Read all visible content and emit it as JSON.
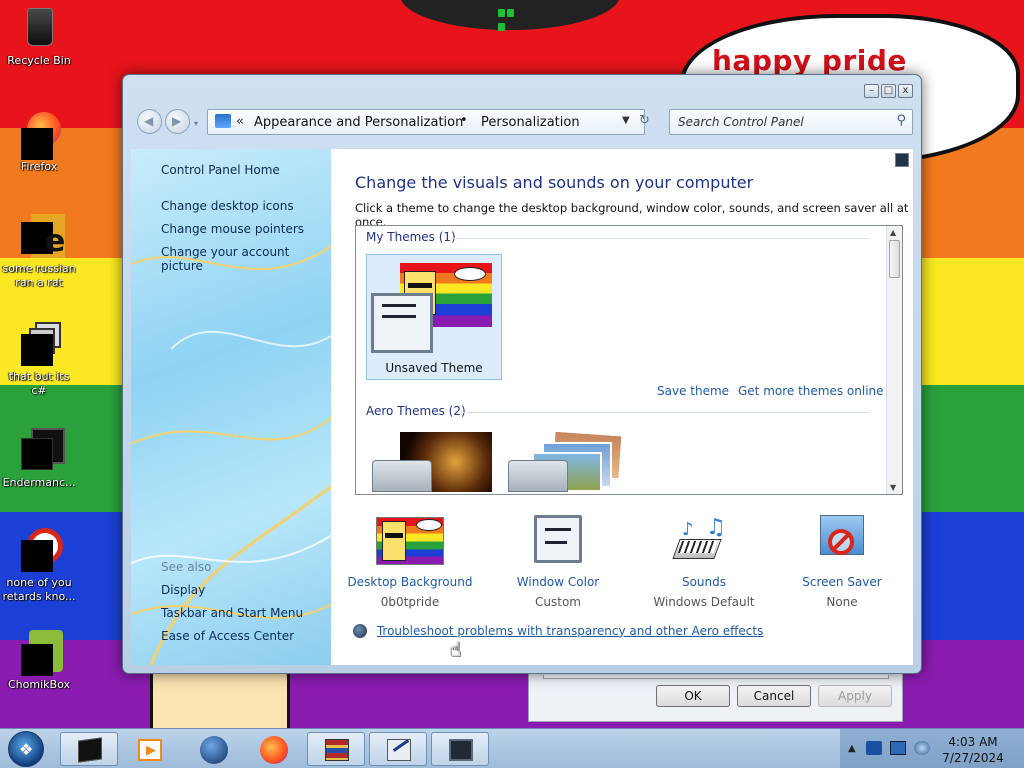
{
  "desktop": {
    "speech_text": "happy pride month",
    "icons": [
      {
        "label": "Recycle Bin",
        "icon": "recycle-bin-icon"
      },
      {
        "label": "Firefox",
        "icon": "firefox-icon"
      },
      {
        "label": "some russian ran a rat",
        "icon": "app-icon"
      },
      {
        "label": "that but its c#",
        "icon": "app-icon"
      },
      {
        "label": "Endermanc...",
        "icon": "app-icon"
      },
      {
        "label": "none of you retards kno...",
        "icon": "app-icon"
      },
      {
        "label": "ChomikBox",
        "icon": "chomikbox-icon"
      }
    ]
  },
  "window": {
    "breadcrumb": {
      "crumb1": "Appearance and Personalization",
      "crumb2": "Personalization"
    },
    "search_placeholder": "Search Control Panel",
    "caption": {
      "minimize": "–",
      "maximize": "□",
      "close": "x"
    },
    "left_pane": {
      "home": "Control Panel Home",
      "links": [
        "Change desktop icons",
        "Change mouse pointers",
        "Change your account picture"
      ],
      "see_also_title": "See also",
      "see_also": [
        "Display",
        "Taskbar and Start Menu",
        "Ease of Access Center"
      ]
    },
    "content": {
      "title": "Change the visuals and sounds on your computer",
      "subtitle": "Click a theme to change the desktop background, window color, sounds, and screen saver all at once.",
      "my_themes_label": "My Themes (1)",
      "unsaved_theme_label": "Unsaved Theme",
      "save_theme": "Save theme",
      "get_more_themes": "Get more themes online",
      "aero_themes_label": "Aero Themes (2)"
    },
    "bottom_items": [
      {
        "title": "Desktop Background",
        "value": "0b0tpride",
        "icon": "desktop-background-icon"
      },
      {
        "title": "Window Color",
        "value": "Custom",
        "icon": "window-color-icon"
      },
      {
        "title": "Sounds",
        "value": "Windows Default",
        "icon": "sounds-icon"
      },
      {
        "title": "Screen Saver",
        "value": "None",
        "icon": "screen-saver-icon"
      }
    ],
    "troubleshoot_link": "Troubleshoot problems with transparency and other Aero effects"
  },
  "dialog": {
    "ok": "OK",
    "cancel": "Cancel",
    "apply": "Apply"
  },
  "taskbar": {
    "apps": [
      "terminal",
      "media-player",
      "globe",
      "firefox",
      "winrar",
      "paint",
      "window"
    ],
    "clock_time": "4:03 AM",
    "clock_date": "7/27/2024"
  }
}
